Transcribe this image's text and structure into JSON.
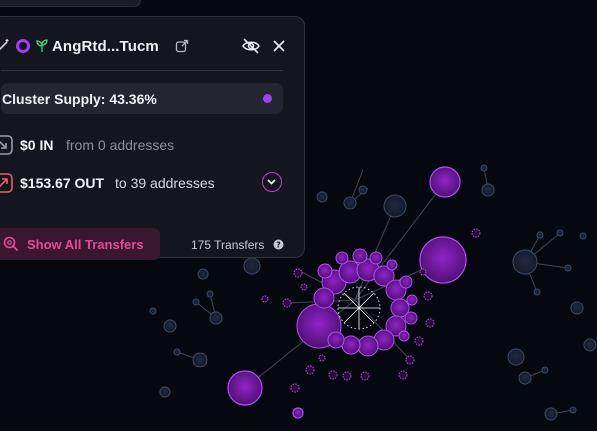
{
  "panel": {
    "address_title": "AngRtd...Tucm",
    "icons": {
      "wand": "magic-wand-icon",
      "ring": "cluster-ring-icon",
      "sprout": "sprout-icon",
      "external": "external-link-icon",
      "hide": "eye-off-icon",
      "close": "close-icon"
    },
    "cluster_supply": "Cluster Supply: 43.36%",
    "cluster_color": "#a43cf0",
    "in": {
      "amount": "$0 IN",
      "detail": "from 0 addresses"
    },
    "out": {
      "amount": "$153.67 OUT",
      "detail": "to 39 addresses"
    },
    "show_all_button": "Show All Transfers",
    "transfers_count": "175 Transfers"
  },
  "colors": {
    "background": "#06080f",
    "panel": "#14161f",
    "accent_purple": "#a43cf0",
    "accent_pink": "#e84898",
    "node_dark": "#1a2236"
  }
}
